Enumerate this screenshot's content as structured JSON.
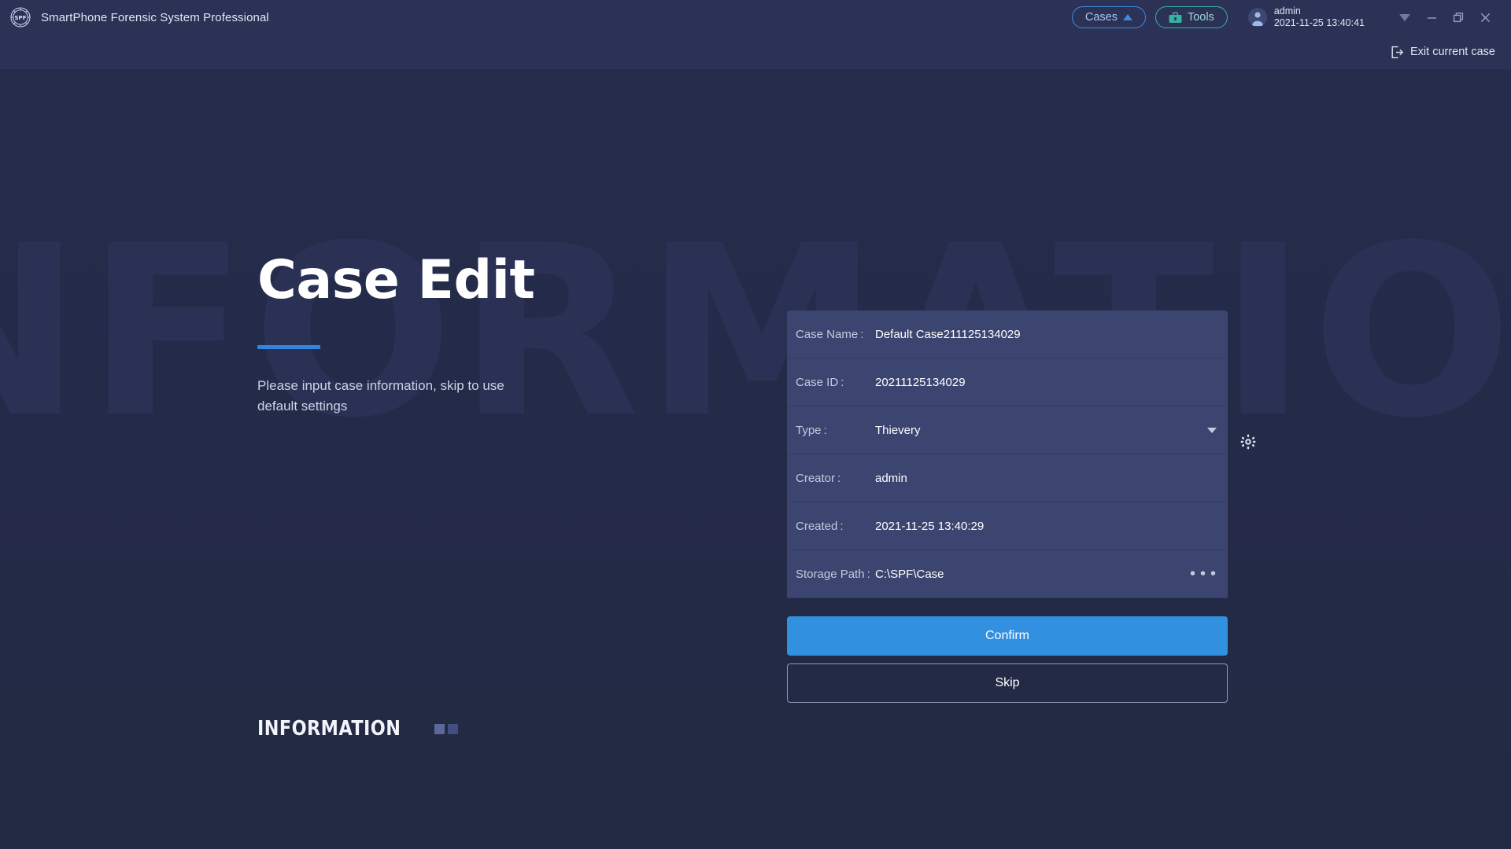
{
  "titlebar": {
    "logo_icon": "spf-logo-icon",
    "app_title": "SmartPhone Forensic System Professional",
    "cases_button": "Cases",
    "cases_caret_icon": "caret-up-icon",
    "tools_button": "Tools",
    "tools_icon": "toolbox-icon",
    "avatar_icon": "user-avatar-icon",
    "user_name": "admin",
    "user_datetime": "2021-11-25 13:40:41",
    "dropdown_icon": "caret-down-icon",
    "minimize_icon": "minimize-icon",
    "restore_icon": "restore-icon",
    "close_icon": "close-icon"
  },
  "subbar": {
    "exit_icon": "exit-icon",
    "exit_label": "Exit current case"
  },
  "background": {
    "watermark_text": "INFORMATION"
  },
  "hero": {
    "title": "Case Edit",
    "subtitle": "Please input case information, skip to use default settings",
    "footer_text": "INFORMATION"
  },
  "form": {
    "fields": [
      {
        "label": "Case Name :",
        "value": "Default Case211125134029",
        "control": "text"
      },
      {
        "label": "Case ID :",
        "value": "20211125134029",
        "control": "text"
      },
      {
        "label": "Type :",
        "value": "Thievery",
        "control": "dropdown"
      },
      {
        "label": "Creator :",
        "value": "admin",
        "control": "text"
      },
      {
        "label": "Created :",
        "value": "2021-11-25 13:40:29",
        "control": "text"
      },
      {
        "label": "Storage Path :",
        "value": "C:\\SPF\\Case",
        "control": "browse"
      }
    ],
    "type_settings_icon": "gear-icon",
    "storage_browse_label": "• • •",
    "confirm_label": "Confirm",
    "skip_label": "Skip"
  },
  "colors": {
    "accent_blue": "#3290e0",
    "titlebar_bg": "#2b3256",
    "main_bg": "#242b49",
    "field_bg": "#3c4570",
    "tools_teal": "#35b2a4"
  }
}
